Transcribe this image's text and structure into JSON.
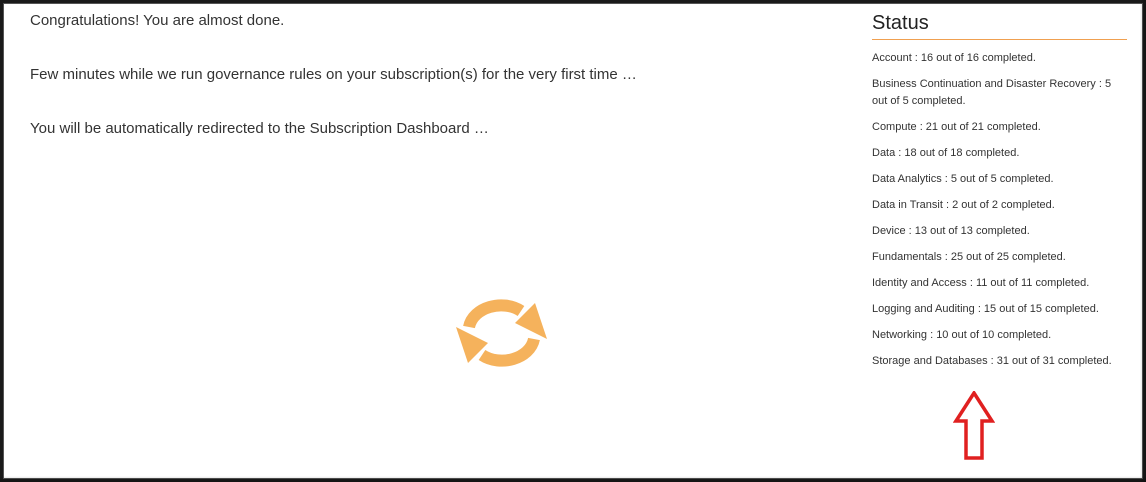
{
  "messages": {
    "congrats": "Congratulations! You are almost done.",
    "running": "Few minutes while we run governance rules on your subscription(s) for the very first time …",
    "redirect": "You will be automatically redirected to the Subscription Dashboard …"
  },
  "spinner": {
    "icon": "refresh-icon",
    "color": "#f5b25c"
  },
  "status": {
    "title": "Status",
    "items": [
      {
        "label": "Account : 16 out of 16 completed."
      },
      {
        "label": "Business Continuation and Disaster Recovery : 5 out of 5 completed."
      },
      {
        "label": "Compute : 21 out of 21 completed."
      },
      {
        "label": "Data : 18 out of 18 completed."
      },
      {
        "label": "Data Analytics : 5 out of 5 completed."
      },
      {
        "label": "Data in Transit : 2 out of 2 completed."
      },
      {
        "label": "Device : 13 out of 13 completed."
      },
      {
        "label": "Fundamentals : 25 out of 25 completed."
      },
      {
        "label": "Identity and Access : 11 out of 11 completed."
      },
      {
        "label": "Logging and Auditing : 15 out of 15 completed."
      },
      {
        "label": "Networking : 10 out of 10 completed."
      },
      {
        "label": "Storage and Databases : 31 out of 31 completed."
      }
    ]
  },
  "annotation": {
    "icon": "up-arrow-icon",
    "color": "#e02020"
  },
  "colors": {
    "accent_underline": "#f0a050",
    "text": "#333333"
  }
}
